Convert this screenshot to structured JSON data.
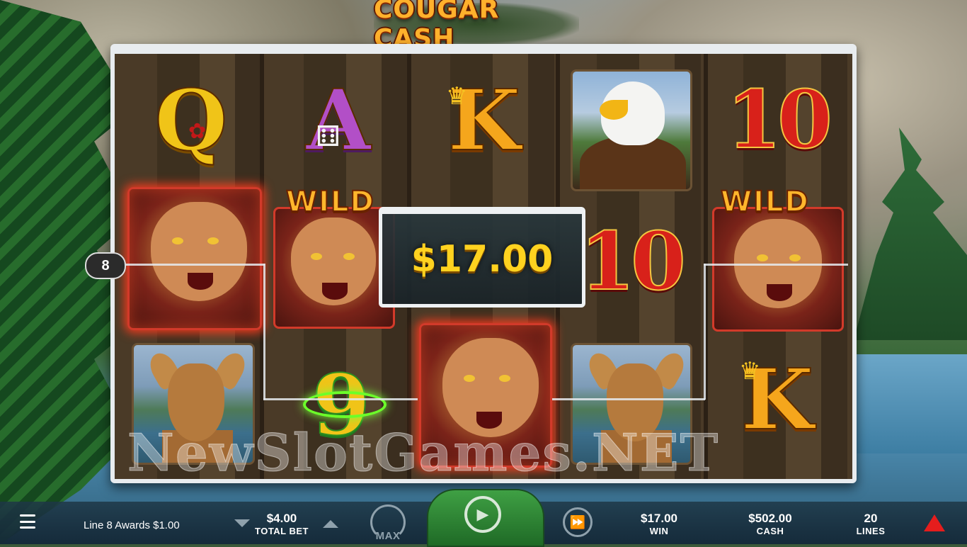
{
  "game": {
    "title": "COUGAR CASH"
  },
  "reels": {
    "row1": {
      "q": "Q",
      "a": "A",
      "k": "K",
      "ten": "10"
    },
    "row2": {
      "ten": "10",
      "wild_left": "WILD",
      "wild_right": "WILD"
    },
    "row3": {
      "nine": "9",
      "k": "K"
    }
  },
  "win_popup": {
    "amount": "$17.00"
  },
  "payline": {
    "number": "8"
  },
  "watermark": "NewSlotGames.NET",
  "bottom_bar": {
    "message": "Line 8 Awards $1.00",
    "total_bet": {
      "value": "$4.00",
      "label": "TOTAL BET"
    },
    "max_label": "MAX",
    "win": {
      "value": "$17.00",
      "label": "WIN"
    },
    "cash": {
      "value": "$502.00",
      "label": "CASH"
    },
    "lines": {
      "value": "20",
      "label": "LINES"
    }
  },
  "colors": {
    "win_gold": "#ffd21f",
    "spin_green": "#3fa044",
    "brand_red": "#e51d1d"
  }
}
